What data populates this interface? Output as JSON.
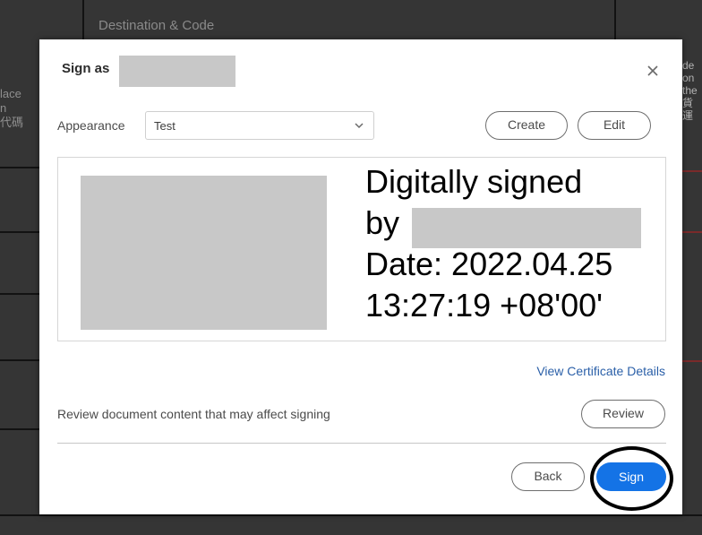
{
  "background": {
    "header": "Destination & Code",
    "left_fragments": [
      "lace",
      "n",
      "代碼"
    ],
    "right_fragments": [
      "de",
      "on",
      "the",
      "貨",
      "運"
    ]
  },
  "dialog": {
    "title": "Sign as",
    "close_icon": "close-icon",
    "appearance": {
      "label": "Appearance",
      "selected": "Test",
      "chevron_icon": "chevron-down-icon"
    },
    "buttons": {
      "create": "Create",
      "edit": "Edit",
      "review": "Review",
      "back": "Back",
      "sign": "Sign"
    },
    "preview": {
      "line1": "Digitally signed",
      "line2": "by",
      "line3": "Date: 2022.04.25",
      "line4": "13:27:19 +08'00'"
    },
    "view_certificate_link": "View Certificate Details",
    "review_message": "Review document content that may affect signing"
  },
  "colors": {
    "accent": "#1473e6",
    "link": "#2a5fa8",
    "annotation": "#000000"
  }
}
